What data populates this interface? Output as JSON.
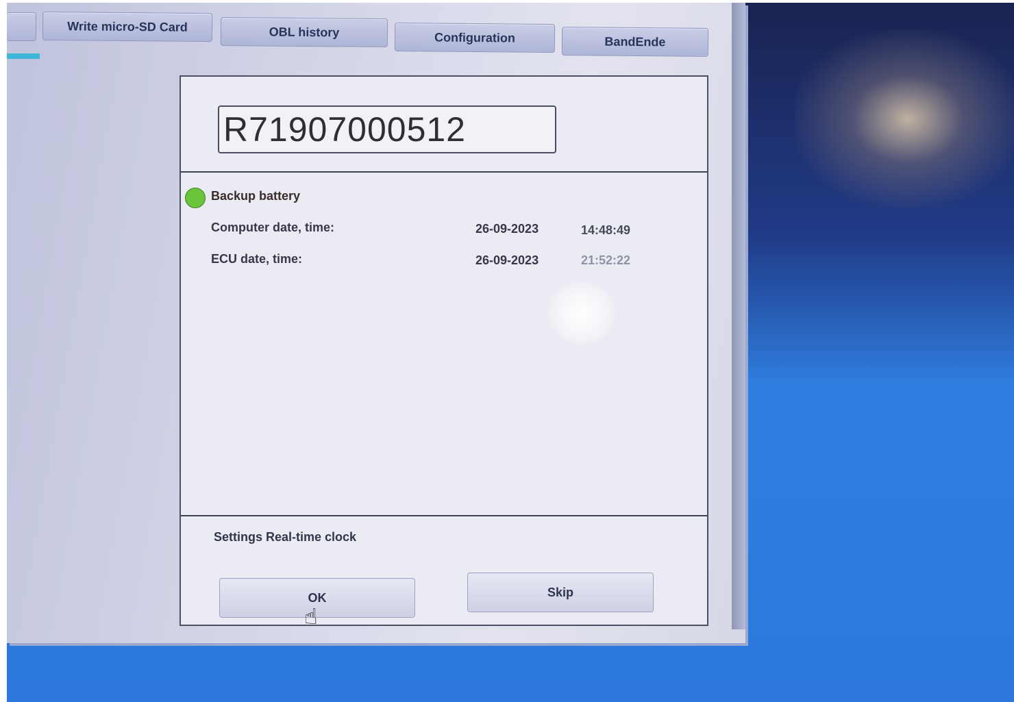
{
  "tabs": [
    {
      "label": "Write micro-SD Card"
    },
    {
      "label": "OBL history"
    },
    {
      "label": "Configuration"
    },
    {
      "label": "BandEnde"
    }
  ],
  "dialog": {
    "serial_number": "R71907000512",
    "battery_label": "Backup battery",
    "battery_status_color": "#6cc43a",
    "computer_label": "Computer date, time:",
    "computer_date": "26-09-2023",
    "computer_time": "14:48:49",
    "ecu_label": "ECU date, time:",
    "ecu_date": "26-09-2023",
    "ecu_time": "21:52:22",
    "status_text": "Settings Real-time clock",
    "ok_label": "OK",
    "skip_label": "Skip"
  },
  "icons": {
    "cursor": "hand-pointer-icon",
    "battery_indicator": "status-dot-icon"
  }
}
